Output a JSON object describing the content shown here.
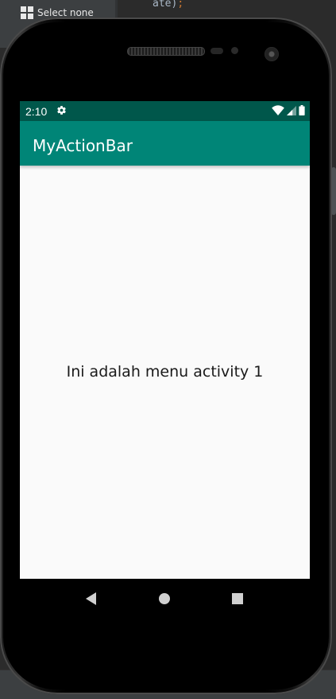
{
  "ide": {
    "menu_item_label": "Select none",
    "code_snippet": "ate)",
    "code_semicolon": ";"
  },
  "status_bar": {
    "time": "2:10",
    "settings_icon": "gear-icon",
    "wifi_icon": "wifi-icon",
    "signal_icon": "signal-icon",
    "battery_icon": "battery-icon"
  },
  "app_bar": {
    "title": "MyActionBar"
  },
  "content": {
    "message": "Ini adalah menu activity 1"
  },
  "nav_bar": {
    "back_icon": "back-icon",
    "home_icon": "home-icon",
    "recents_icon": "recents-icon"
  },
  "colors": {
    "status_bar": "#00574b",
    "app_bar": "#008577",
    "screen_background": "#fafafa"
  }
}
